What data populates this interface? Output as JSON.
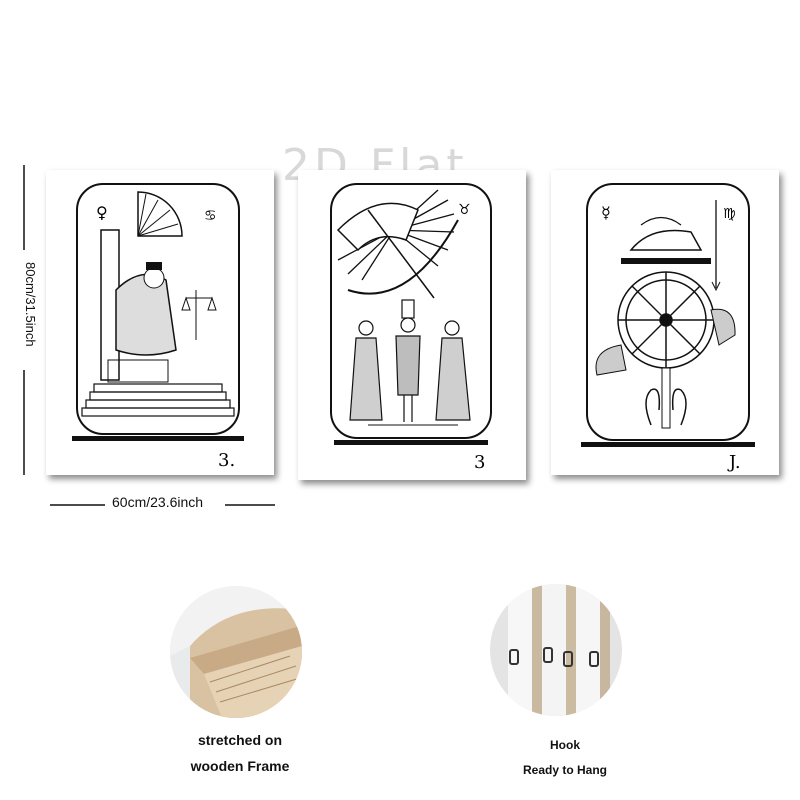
{
  "watermark": "2D Flat",
  "dimensions": {
    "height_label": "80cm/31.5inch",
    "width_label": "60cm/23.6inch"
  },
  "panels": [
    {
      "signature": "3.",
      "symbols": [
        "♀",
        "♋"
      ]
    },
    {
      "signature": "3",
      "symbols": [
        "♉"
      ]
    },
    {
      "signature": "J.",
      "symbols": [
        "☿",
        "♍"
      ]
    }
  ],
  "features": {
    "frame": {
      "line1": "stretched on",
      "line2": "wooden Frame"
    },
    "hook": {
      "line1": "Hook",
      "line2": "Ready to Hang"
    }
  }
}
